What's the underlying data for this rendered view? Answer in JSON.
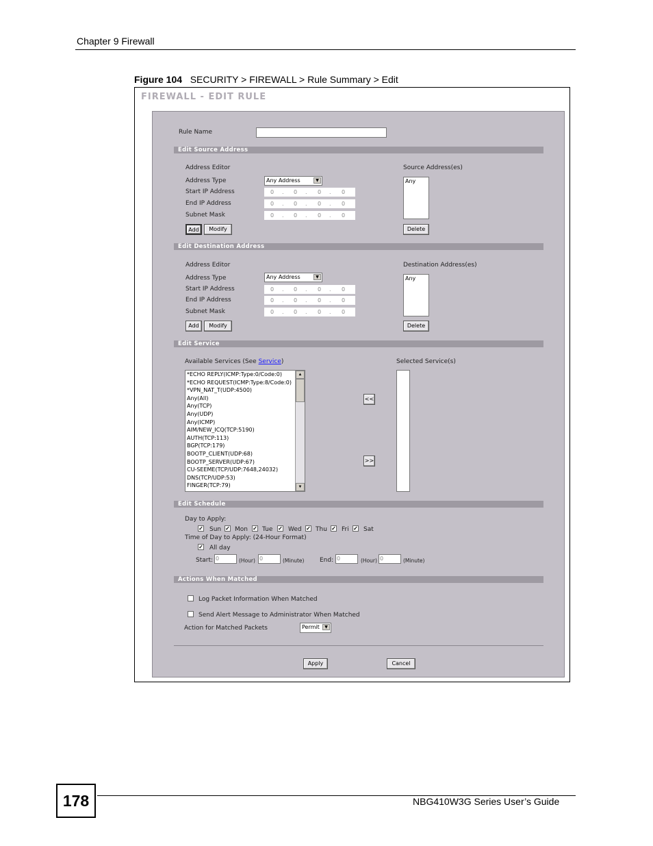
{
  "header": {
    "chapter": "Chapter 9 Firewall"
  },
  "figure": {
    "label": "Figure 104",
    "caption": "SECURITY > FIREWALL > Rule Summary > Edit"
  },
  "panel": {
    "title": "FIREWALL - EDIT RULE"
  },
  "rule_name": {
    "label": "Rule Name",
    "value": ""
  },
  "source": {
    "section": "Edit Source Address",
    "editor_label": "Address Editor",
    "type_label": "Address Type",
    "type_value": "Any Address",
    "start_label": "Start IP Address",
    "end_label": "End IP Address",
    "mask_label": "Subnet Mask",
    "ip_octet": "0",
    "ip_dot": ".",
    "add": "Add",
    "modify": "Modify",
    "list_label": "Source Address(es)",
    "list_items": [
      "Any"
    ],
    "delete": "Delete"
  },
  "destination": {
    "section": "Edit Destination Address",
    "editor_label": "Address Editor",
    "type_label": "Address Type",
    "type_value": "Any Address",
    "start_label": "Start IP Address",
    "end_label": "End IP Address",
    "mask_label": "Subnet Mask",
    "ip_octet": "0",
    "ip_dot": ".",
    "add": "Add",
    "modify": "Modify",
    "list_label": "Destination Address(es)",
    "list_items": [
      "Any"
    ],
    "delete": "Delete"
  },
  "service": {
    "section": "Edit Service",
    "available_label": "Available Services  (See ",
    "available_link": "Service",
    "available_close": ")",
    "selected_label": "Selected Service(s)",
    "items": [
      "*ECHO REPLY(ICMP:Type:0/Code:0)",
      "*ECHO REQUEST(ICMP:Type:8/Code:0)",
      "*VPN_NAT_T(UDP:4500)",
      "Any(All)",
      "Any(TCP)",
      "Any(UDP)",
      "Any(ICMP)",
      "AIM/NEW_ICQ(TCP:5190)",
      "AUTH(TCP:113)",
      "BGP(TCP:179)",
      "BOOTP_CLIENT(UDP:68)",
      "BOOTP_SERVER(UDP:67)",
      "CU-SEEME(TCP/UDP:7648,24032)",
      "DNS(TCP/UDP:53)",
      "FINGER(TCP:79)"
    ],
    "remove_btn": "<<",
    "add_btn": ">>"
  },
  "schedule": {
    "section": "Edit Schedule",
    "day_label": "Day to Apply:",
    "days": [
      "Sun",
      "Mon",
      "Tue",
      "Wed",
      "Thu",
      "Fri",
      "Sat"
    ],
    "time_label": "Time of Day to Apply: (24-Hour Format)",
    "all_day": "All day",
    "start_label": "Start:",
    "end_label": "End:",
    "hour_unit": "(Hour)",
    "minute_unit": "(Minute)",
    "start_hour": "0",
    "start_minute": "0",
    "end_hour": "0",
    "end_minute": "0"
  },
  "actions": {
    "section": "Actions When Matched",
    "log_label": "Log Packet Information When Matched",
    "alert_label": "Send Alert Message to Administrator When Matched",
    "action_label": "Action for Matched Packets",
    "action_value": "Permit"
  },
  "buttons": {
    "apply": "Apply",
    "cancel": "Cancel"
  },
  "footer": {
    "page_number": "178",
    "guide": "NBG410W3G Series User’s Guide"
  }
}
